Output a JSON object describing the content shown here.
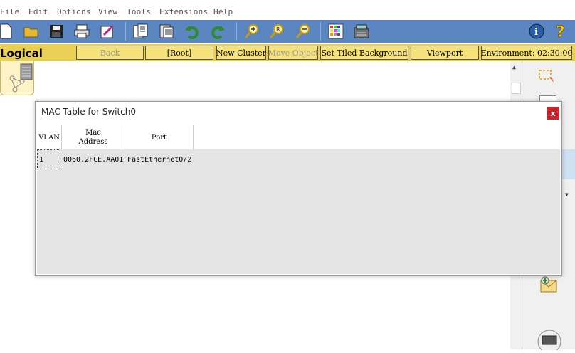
{
  "menu": [
    "File",
    "Edit",
    "Options",
    "View",
    "Tools",
    "Extensions",
    "Help"
  ],
  "toolbar_icons": [
    "new-file-icon",
    "open-folder-icon",
    "save-icon",
    "print-icon",
    "activity-wizard-icon",
    "copy-icon",
    "paste-icon",
    "undo-icon",
    "redo-icon",
    "zoom-in-icon",
    "zoom-reset-icon",
    "zoom-out-icon",
    "palette-icon",
    "custom-device-icon",
    "info-icon",
    "help-icon"
  ],
  "logical_bar": {
    "label": "Logical",
    "back": "Back",
    "root": "[Root]",
    "new_cluster": "New Cluster",
    "move_object": "Move Object",
    "set_tiled_background": "Set Tiled Background",
    "viewport": "Viewport",
    "environment": "Environment: 02:30:00"
  },
  "dialog": {
    "title": "MAC Table for Switch0",
    "close": "x",
    "columns": [
      "VLAN",
      "Mac\nAddress",
      "Port"
    ],
    "rows": [
      {
        "vlan": "1",
        "mac": "0060.2FCE.AA01",
        "port": "FastEthernet0/2"
      }
    ]
  }
}
